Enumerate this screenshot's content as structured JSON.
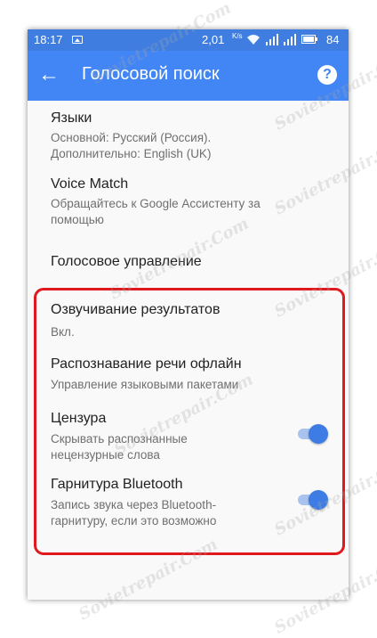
{
  "statusbar": {
    "time": "18:17",
    "speed": "2,01",
    "speed_unit": "K/s",
    "battery": "84",
    "icons": [
      "image-icon",
      "wifi-icon",
      "signal-icon",
      "signal-icon",
      "battery-icon"
    ]
  },
  "toolbar": {
    "back_icon": "←",
    "title": "Голосовой поиск",
    "help_icon": "?"
  },
  "settings": [
    {
      "title": "Языки",
      "subtitle_lines": [
        "Основной: Русский (Россия).",
        "Дополнительно: English (UK)"
      ]
    },
    {
      "title": "Voice Match",
      "subtitle_lines": [
        "Обращайтесь к Google Ассистенту за",
        "помощью"
      ]
    },
    {
      "title": "Голосовое управление",
      "subtitle_lines": []
    },
    {
      "title": "Озвучивание результатов",
      "subtitle_lines": [
        "Вкл."
      ]
    },
    {
      "title": "Распознавание речи офлайн",
      "subtitle_lines": [
        "Управление языковыми пакетами"
      ]
    },
    {
      "title": "Цензура",
      "subtitle_lines": [
        "Скрывать распознанные",
        "нецензурные слова"
      ],
      "toggle_on": true
    },
    {
      "title": "Гарнитура Bluetooth",
      "subtitle_lines": [
        "Запись звука через Bluetooth-",
        "гарнитуру, если это возможно"
      ],
      "toggle_on": true
    }
  ],
  "watermark": "Sovietrepair.Com",
  "colors": {
    "status_bar": "#3f7ee0",
    "toolbar": "#4285f4",
    "toggle_thumb": "#3c7ce4",
    "toggle_track": "#a9c3ef",
    "highlight_border": "#e0191f"
  }
}
